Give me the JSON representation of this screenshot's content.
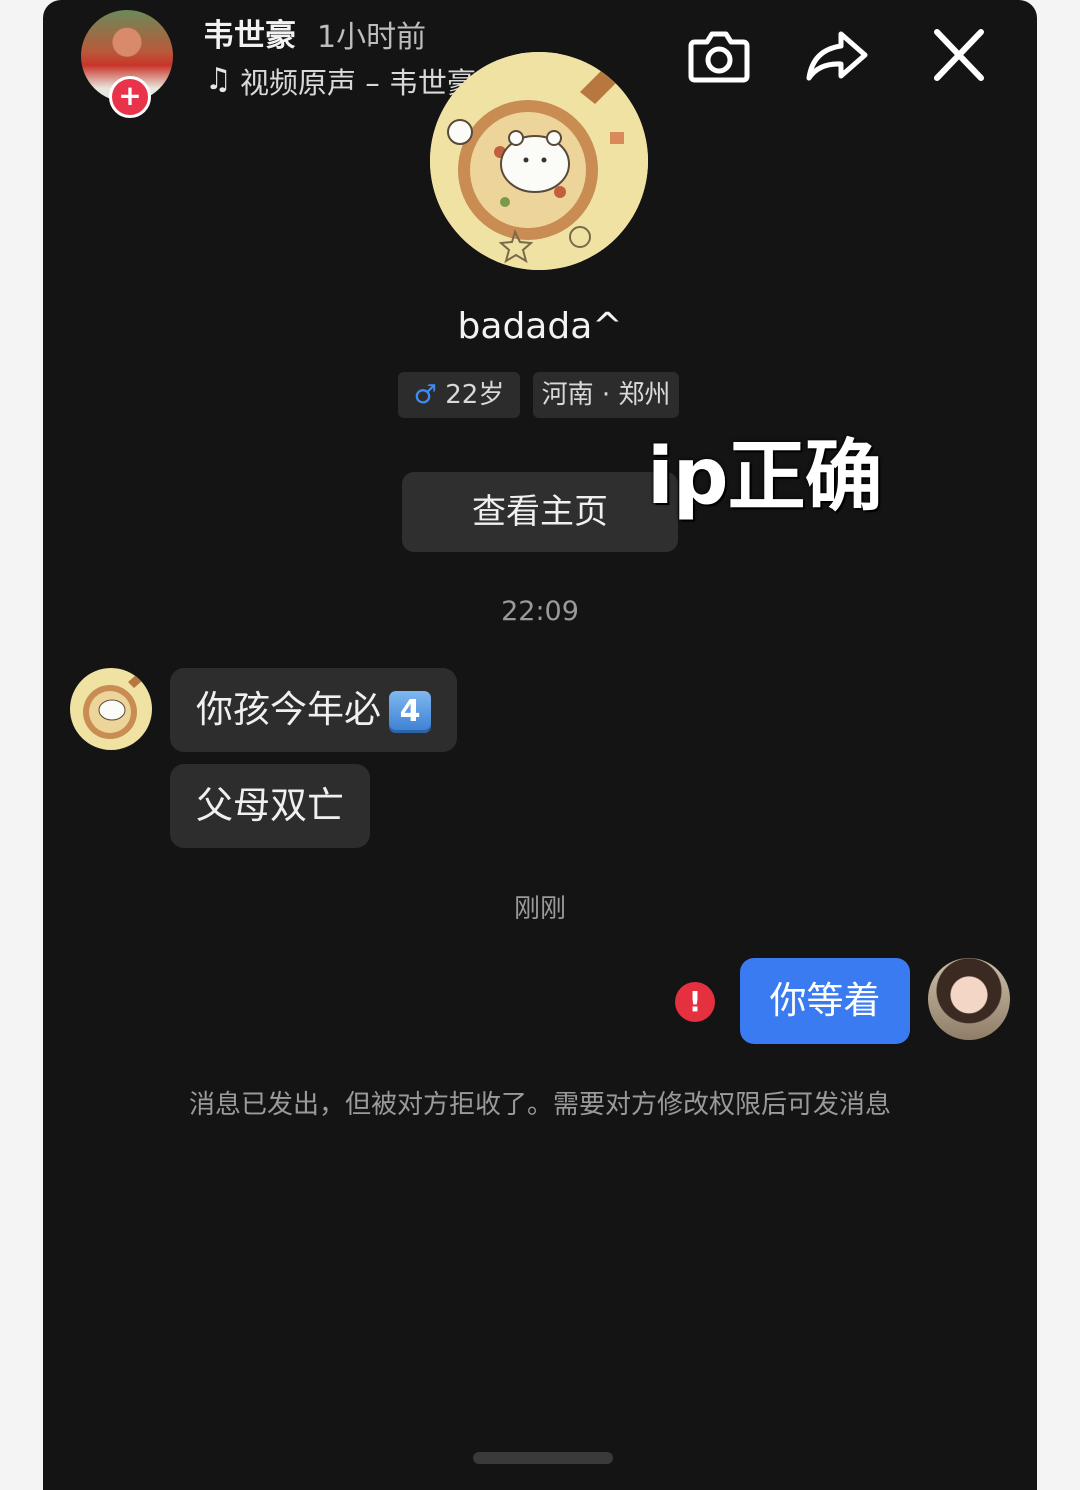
{
  "header": {
    "author_name": "韦世豪",
    "post_time": "1小时前",
    "music_text": "视频原声 – 韦世豪 ›",
    "follow_symbol": "+",
    "icons": [
      "music-note-icon",
      "camera-icon",
      "share-icon",
      "close-icon"
    ]
  },
  "profile": {
    "username": "badada^",
    "gender_symbol": "♂",
    "age": "22岁",
    "location": "河南 · 郑州",
    "view_profile_label": "查看主页"
  },
  "overlay_caption": "ip正确",
  "conversation": {
    "time_1": "22:09",
    "received": [
      {
        "text": "你孩今年必",
        "emoji": "4"
      },
      {
        "text": "父母双亡"
      }
    ],
    "time_2": "刚刚",
    "sent": {
      "text": "你等着",
      "error_symbol": "!"
    },
    "notice": "消息已发出，但被对方拒收了。需要对方修改权限后可发消息"
  },
  "colors": {
    "background": "#141414",
    "bubble_received": "#2d2d2d",
    "bubble_sent": "#3a7bf2",
    "error": "#e5303f",
    "follow": "#e8334a"
  }
}
